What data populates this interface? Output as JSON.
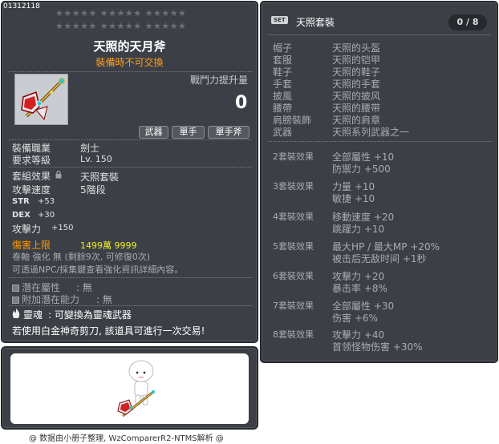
{
  "item": {
    "id": "01312118",
    "stars_row1": "★★★★★  ★★★★★  ★★★★★",
    "stars_row2": "★★★★★  ★★★★★  ★★★★★",
    "name": "天照的天月斧",
    "tradable": "裝備時不可交換",
    "power_label": "戰鬥力提升量",
    "power_value": "0",
    "tags": [
      "武器",
      "單手",
      "單手斧"
    ],
    "job_label": "裝備職業",
    "job_value": "劍士",
    "req_label": "要求等級",
    "req_value": "Lv. 150",
    "set_label": "套組效果",
    "set_value": "天照套裝",
    "speed_label": "攻擊速度",
    "speed_value": "5階段",
    "str_label": "STR",
    "str_value": "+53",
    "dex_label": "DEX",
    "dex_value": "+30",
    "att_label": "攻擊力",
    "att_value": "+150",
    "damage_cap_label": "傷害上限",
    "damage_cap_value": "1499萬 9999",
    "scroll_text": "卷軸 強化 無 (剩餘9次, 可修復0次)",
    "npc_text": "可透過NPC/採集鍵查看強化資訊詳細內容。",
    "potential_label": "潛在屬性",
    "potential_value": ": 無",
    "add_potential_label": "附加潛在能力",
    "add_potential_value": ": 無",
    "soul_label": "靈魂",
    "soul_value": ": 可變換為靈魂武器",
    "scissors_text": "若使用白金神奇剪刀, 該道具可進行一次交易!"
  },
  "set": {
    "badge": "SET",
    "name": "天照套裝",
    "count": "0 / 8",
    "pieces": [
      {
        "slot": "帽子",
        "name": "天照的头盔"
      },
      {
        "slot": "套服",
        "name": "天照的铠甲"
      },
      {
        "slot": "鞋子",
        "name": "天照的鞋子"
      },
      {
        "slot": "手套",
        "name": "天照的手套"
      },
      {
        "slot": "披風",
        "name": "天照的披风"
      },
      {
        "slot": "腰帶",
        "name": "天照的腰带"
      },
      {
        "slot": "肩膀裝飾",
        "name": "天照的肩章"
      },
      {
        "slot": "武器",
        "name": "天照系列武器之一"
      }
    ],
    "effects": [
      {
        "tier": "2套裝效果",
        "stats": [
          "全部屬性  +10",
          "防禦力  +500"
        ]
      },
      {
        "tier": "3套裝效果",
        "stats": [
          "力量  +10",
          "敏捷  +10"
        ]
      },
      {
        "tier": "4套裝效果",
        "stats": [
          "移動速度  +20",
          "跳躍力  +10"
        ]
      },
      {
        "tier": "5套裝效果",
        "stats": [
          "最大HP / 最大MP  +20%",
          "被击后无敌时间  +1秒"
        ]
      },
      {
        "tier": "6套裝效果",
        "stats": [
          "攻擊力  +20",
          "暴击率  +8%"
        ]
      },
      {
        "tier": "7套裝效果",
        "stats": [
          "全部屬性  +30",
          "伤害  +6%"
        ]
      },
      {
        "tier": "8套裝效果",
        "stats": [
          "攻擊力  +40",
          "首领怪物伤害  +30%"
        ]
      }
    ]
  },
  "footer": "@ 数据由小册子整理, WzComparerR2-NTMS解析 @",
  "icons": {
    "weapon": "axe-icon",
    "avatar": "character-avatar",
    "lock": "lock-icon",
    "soul": "soul-flame-icon"
  }
}
